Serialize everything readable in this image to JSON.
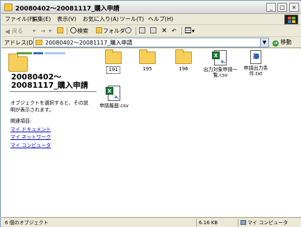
{
  "window": {
    "title": "20080402～20081117_購入申請",
    "buttons": {
      "minimize": "_",
      "maximize": "□",
      "close": "×"
    }
  },
  "menu": {
    "items": [
      "ファイル(F)",
      "編集(E)",
      "表示(V)",
      "お気に入り(A)",
      "ツール(T)",
      "ヘルプ(H)"
    ]
  },
  "toolbar": {
    "back": "戻る",
    "search": "検索",
    "folders": "フォルダ"
  },
  "address": {
    "label": "アドレス(D)",
    "path": "20080402～20081117_購入申請",
    "go": "移動"
  },
  "left_pane": {
    "title": "20080402～20081117_購入申請",
    "description": "オブジェクトを選択すると、その説明が表示されます。",
    "related_heading": "関連項目:",
    "links": [
      "マイ ドキュメント",
      "マイ ネットワーク",
      "マイ コンピュータ"
    ]
  },
  "files": [
    {
      "name": "191",
      "type": "folder"
    },
    {
      "name": "195",
      "type": "folder"
    },
    {
      "name": "196",
      "type": "folder"
    },
    {
      "name": "出力対象申請一覧.csv",
      "type": "csv"
    },
    {
      "name": "申請出力条件.txt",
      "type": "txt"
    },
    {
      "name": "申請履歴.csv",
      "type": "csv"
    }
  ],
  "status": {
    "objects": "6 個のオブジェクト",
    "size": "6.16 KB",
    "location": "マイ コンピュータ"
  },
  "colors": {
    "folder": "#f6cf5a",
    "link": "#0000cc",
    "excel_badge": "#1d7a3a"
  }
}
